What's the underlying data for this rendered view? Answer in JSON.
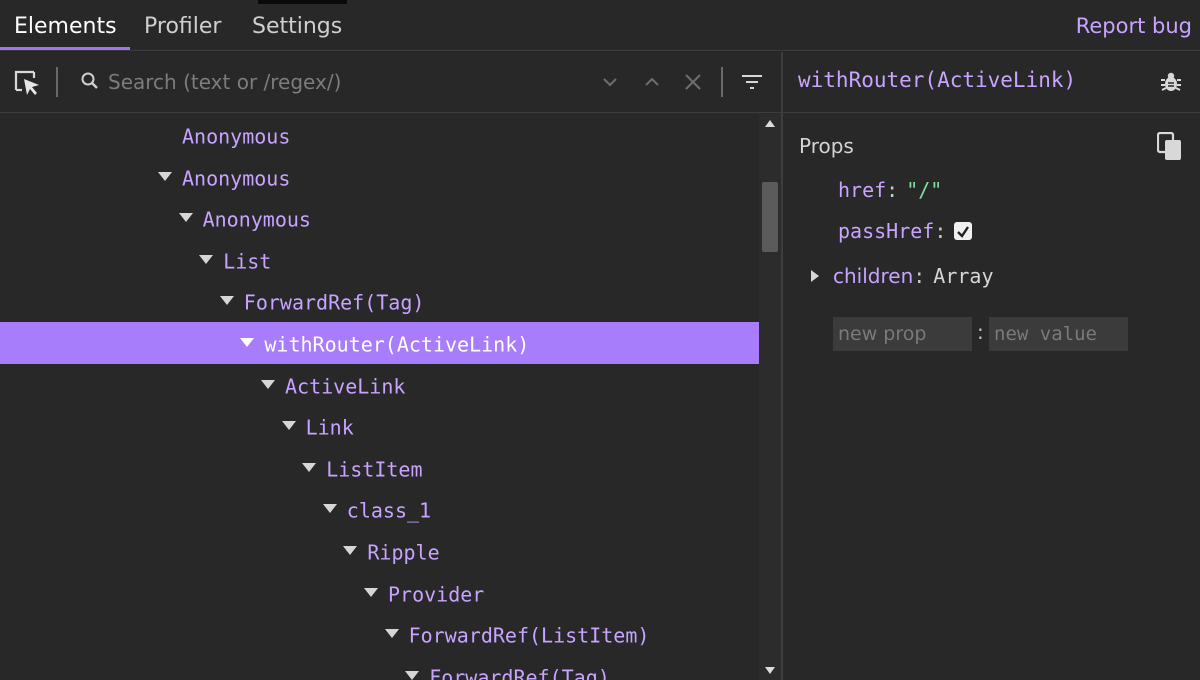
{
  "tabs": {
    "elements": "Elements",
    "profiler": "Profiler",
    "settings": "Settings",
    "report_bug": "Report bug"
  },
  "toolbar": {
    "search_placeholder": "Search (text or /regex/)",
    "inspect_icon": "inspect-element-icon",
    "search_icon": "search-icon",
    "prev_icon": "chevron-down-icon",
    "next_icon": "chevron-up-icon",
    "clear_icon": "close-icon",
    "filter_icon": "filter-icon"
  },
  "tree": {
    "rows": [
      {
        "label": "Anonymous",
        "depth": 0,
        "expanded": false,
        "selected": false
      },
      {
        "label": "Anonymous",
        "depth": 0,
        "expanded": true,
        "selected": false
      },
      {
        "label": "Anonymous",
        "depth": 1,
        "expanded": true,
        "selected": false
      },
      {
        "label": "List",
        "depth": 2,
        "expanded": true,
        "selected": false
      },
      {
        "label": "ForwardRef(Tag)",
        "depth": 3,
        "expanded": true,
        "selected": false
      },
      {
        "label": "withRouter(ActiveLink)",
        "depth": 4,
        "expanded": true,
        "selected": true
      },
      {
        "label": "ActiveLink",
        "depth": 5,
        "expanded": true,
        "selected": false
      },
      {
        "label": "Link",
        "depth": 6,
        "expanded": true,
        "selected": false
      },
      {
        "label": "ListItem",
        "depth": 7,
        "expanded": true,
        "selected": false
      },
      {
        "label": "class_1",
        "depth": 8,
        "expanded": true,
        "selected": false
      },
      {
        "label": "Ripple",
        "depth": 9,
        "expanded": true,
        "selected": false
      },
      {
        "label": "Provider",
        "depth": 10,
        "expanded": true,
        "selected": false
      },
      {
        "label": "ForwardRef(ListItem)",
        "depth": 11,
        "expanded": true,
        "selected": false
      },
      {
        "label": "ForwardRef(Tag)",
        "depth": 12,
        "expanded": true,
        "selected": false
      }
    ]
  },
  "inspector": {
    "component_name": "withRouter(ActiveLink)",
    "bug_icon": "bug-icon",
    "props_title": "Props",
    "copy_icon": "copy-icon",
    "props": {
      "href_key": "href",
      "href_value": "\"/\"",
      "passHref_key": "passHref",
      "passHref_checked": true,
      "children_key": "children",
      "children_value": "Array"
    },
    "new_prop_placeholder": "new prop",
    "new_value_placeholder": "new value"
  },
  "colors": {
    "accent": "#a275f0",
    "selected_row": "#a87dfb",
    "component_name": "#c8a3ff",
    "string_value": "#7fe0a2",
    "background": "#282828"
  }
}
